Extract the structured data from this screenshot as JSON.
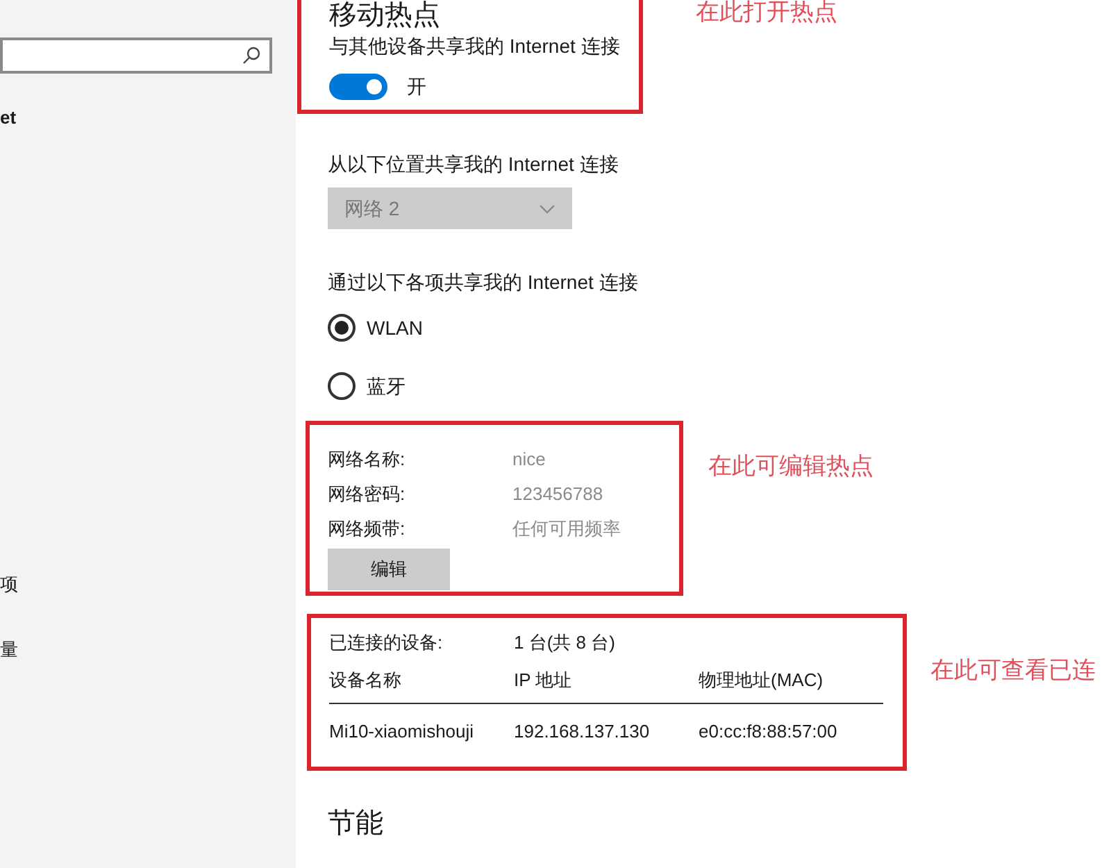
{
  "sidebar": {
    "title": "et",
    "items": [
      {
        "label": "项"
      },
      {
        "label": "量"
      }
    ]
  },
  "hotspot": {
    "title": "移动热点",
    "share_label": "与其他设备共享我的 Internet 连接",
    "toggle": {
      "on": true,
      "label": "开"
    },
    "annotation": "在此打开热点"
  },
  "share_from": {
    "label": "从以下位置共享我的 Internet 连接",
    "dropdown": {
      "value": "网络 2",
      "disabled": true
    }
  },
  "share_over": {
    "label": "通过以下各项共享我的 Internet 连接",
    "options": [
      {
        "label": "WLAN",
        "selected": true
      },
      {
        "label": "蓝牙",
        "selected": false
      }
    ]
  },
  "network": {
    "rows": [
      {
        "label": "网络名称:",
        "value": "nice"
      },
      {
        "label": "网络密码:",
        "value": "123456788"
      },
      {
        "label": "网络频带:",
        "value": "任何可用频率"
      }
    ],
    "edit_button": "编辑",
    "annotation": "在此可编辑热点"
  },
  "devices": {
    "label": "已连接的设备:",
    "count": "1 台(共 8 台)",
    "columns": [
      "设备名称",
      "IP 地址",
      "物理地址(MAC)"
    ],
    "rows": [
      [
        "Mi10-xiaomishouji",
        "192.168.137.130",
        "e0:cc:f8:88:57:00"
      ]
    ],
    "annotation": "在此可查看已连"
  },
  "power_saving": {
    "title": "节能"
  }
}
